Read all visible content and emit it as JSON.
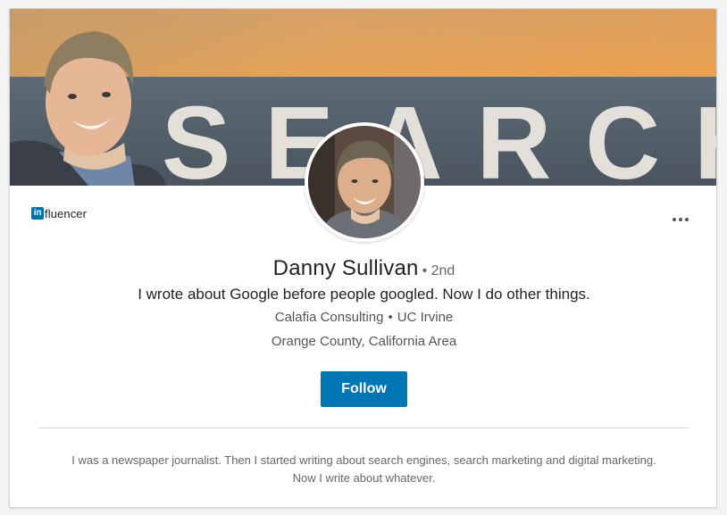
{
  "profile": {
    "name": "Danny Sullivan",
    "degree": "• 2nd",
    "headline": "I wrote about Google before people googled. Now I do other things.",
    "company": "Calafia Consulting",
    "school": "UC Irvine",
    "separator": "•",
    "location": "Orange County, California Area",
    "summary": "I was a newspaper journalist. Then I started writing about search engines, search marketing and digital marketing. Now I write about whatever."
  },
  "badge": {
    "logo": "in",
    "text": "fluencer"
  },
  "banner": {
    "sign_text": "SEARCH"
  },
  "actions": {
    "follow_label": "Follow",
    "more_icon": "more-horizontal-icon"
  },
  "colors": {
    "accent": "#0077b5",
    "logo_blue": "#0073b1"
  }
}
